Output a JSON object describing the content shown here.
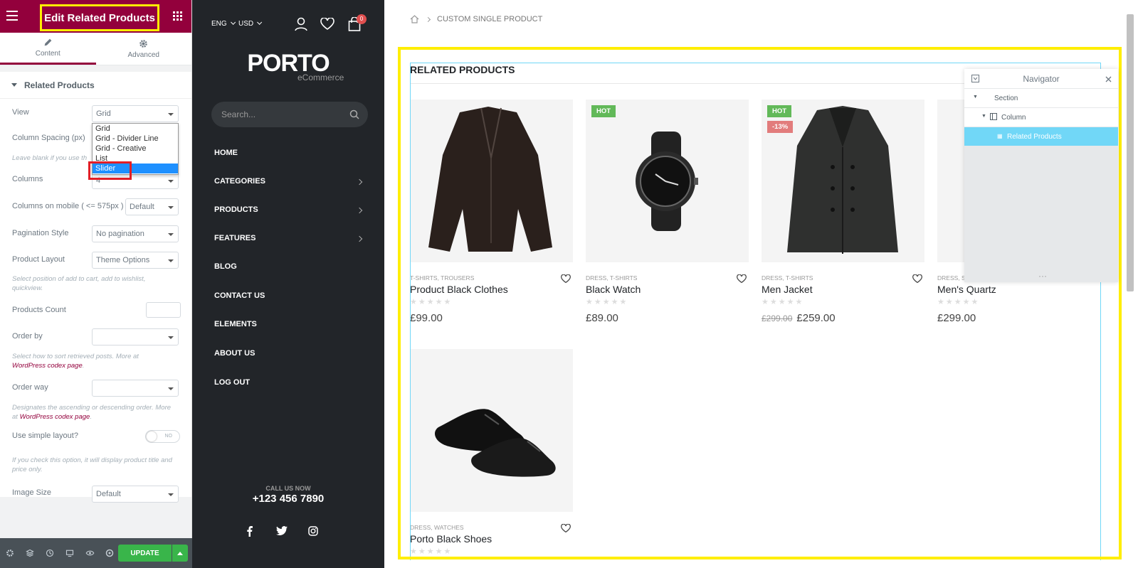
{
  "panel": {
    "title": "Edit Related Products",
    "tabs": [
      {
        "label": "Content",
        "icon": "pencil-icon"
      },
      {
        "label": "Advanced",
        "icon": "gear-icon"
      }
    ],
    "section": "Related Products",
    "controls": {
      "view": {
        "label": "View",
        "value": "Grid",
        "options": [
          "Grid",
          "Grid - Divider Line",
          "Grid - Creative",
          "List",
          "Slider"
        ],
        "highlighted": "Slider"
      },
      "column_spacing": {
        "label": "Column Spacing (px)",
        "desc": "Leave blank if you use th"
      },
      "columns": {
        "label": "Columns",
        "value": "4"
      },
      "columns_mobile": {
        "label": "Columns on mobile ( <= 575px )",
        "value": "Default"
      },
      "pagination": {
        "label": "Pagination Style",
        "value": "No pagination"
      },
      "product_layout": {
        "label": "Product Layout",
        "value": "Theme Options",
        "desc": "Select position of add to cart, add to wishlist, quickview."
      },
      "products_count": {
        "label": "Products Count"
      },
      "order_by": {
        "label": "Order by",
        "desc_pre": "Select how to sort retrieved posts. More at ",
        "desc_link": "WordPress codex page",
        "desc_post": "."
      },
      "order_way": {
        "label": "Order way",
        "desc_pre": "Designates the ascending or descending order. More at ",
        "desc_link": "WordPress codex page",
        "desc_post": "."
      },
      "simple_layout": {
        "label": "Use simple layout?",
        "toggle": "NO",
        "desc": "If you check this option, it will display product title and price only."
      },
      "image_size": {
        "label": "Image Size",
        "value": "Default"
      }
    },
    "footer": {
      "update_label": "UPDATE"
    }
  },
  "store": {
    "lang": "ENG",
    "currency": "USD",
    "cart_count": "0",
    "logo": "PORTO",
    "logo_sub": "eCommerce",
    "search_placeholder": "Search...",
    "menu": [
      "HOME",
      "CATEGORIES",
      "PRODUCTS",
      "FEATURES",
      "BLOG",
      "CONTACT US",
      "ELEMENTS",
      "ABOUT US",
      "LOG OUT"
    ],
    "call_label": "CALL US NOW",
    "phone": "+123 456 7890"
  },
  "main": {
    "breadcrumb": "CUSTOM SINGLE PRODUCT",
    "section_title": "RELATED PRODUCTS",
    "products": [
      {
        "cat": "T-SHIRTS, TROUSERS",
        "name": "Product Black Clothes",
        "price": "£99.00",
        "old": "",
        "badges": []
      },
      {
        "cat": "DRESS, T-SHIRTS",
        "name": "Black Watch",
        "price": "£89.00",
        "old": "",
        "badges": [
          "HOT"
        ]
      },
      {
        "cat": "DRESS, T-SHIRTS",
        "name": "Men Jacket",
        "price": "£259.00",
        "old": "£299.00",
        "badges": [
          "HOT",
          "-13%"
        ]
      },
      {
        "cat": "DRESS, SH",
        "name": "Men's Quartz",
        "price": "£299.00",
        "old": "",
        "badges": []
      },
      {
        "cat": "DRESS, WATCHES",
        "name": "Porto Black Shoes",
        "price": "",
        "old": "",
        "badges": []
      }
    ],
    "navigator": {
      "title": "Navigator",
      "items": [
        "Section",
        "Column",
        "Related Products"
      ]
    }
  },
  "colors": {
    "brand": "#93003c",
    "accent_green": "#39b54a",
    "highlight_yellow": "#ffee00",
    "hot": "#62b959",
    "sale": "#e27c7c"
  }
}
